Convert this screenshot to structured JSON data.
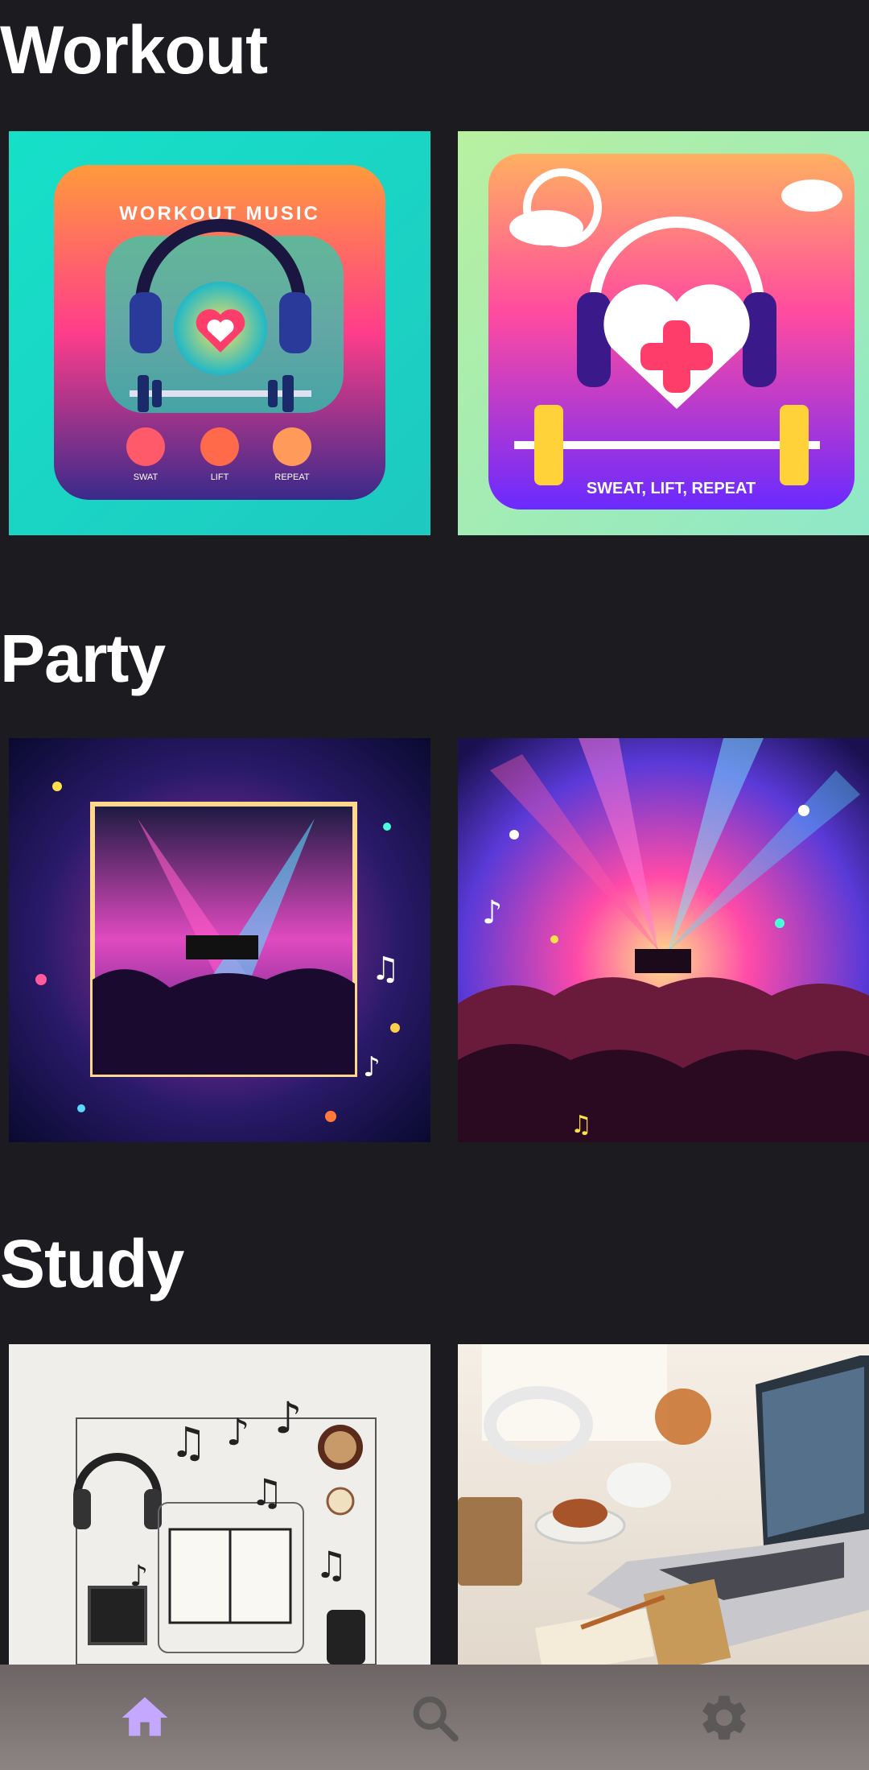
{
  "sections": [
    {
      "title": "Workout",
      "cards": [
        {
          "icon": "workout-music-cover",
          "text": "WORKOUT MUSIC",
          "labels": [
            "SWAT",
            "LIFT",
            "REPEAT"
          ]
        },
        {
          "icon": "sweat-lift-repeat-cover",
          "text": "SWEAT, LIFT, REPEAT"
        }
      ]
    },
    {
      "title": "Party",
      "cards": [
        {
          "icon": "party-stage-frame-cover"
        },
        {
          "icon": "party-crowd-cover"
        }
      ]
    },
    {
      "title": "Study",
      "cards": [
        {
          "icon": "study-desk-music-cover"
        },
        {
          "icon": "study-laptop-tea-cover"
        }
      ]
    }
  ],
  "nav": [
    {
      "icon": "home-icon",
      "active": true,
      "color": "#c4a8ff"
    },
    {
      "icon": "search-icon",
      "active": false,
      "color": "#5c5858"
    },
    {
      "icon": "gear-icon",
      "active": false,
      "color": "#5c5858"
    }
  ]
}
